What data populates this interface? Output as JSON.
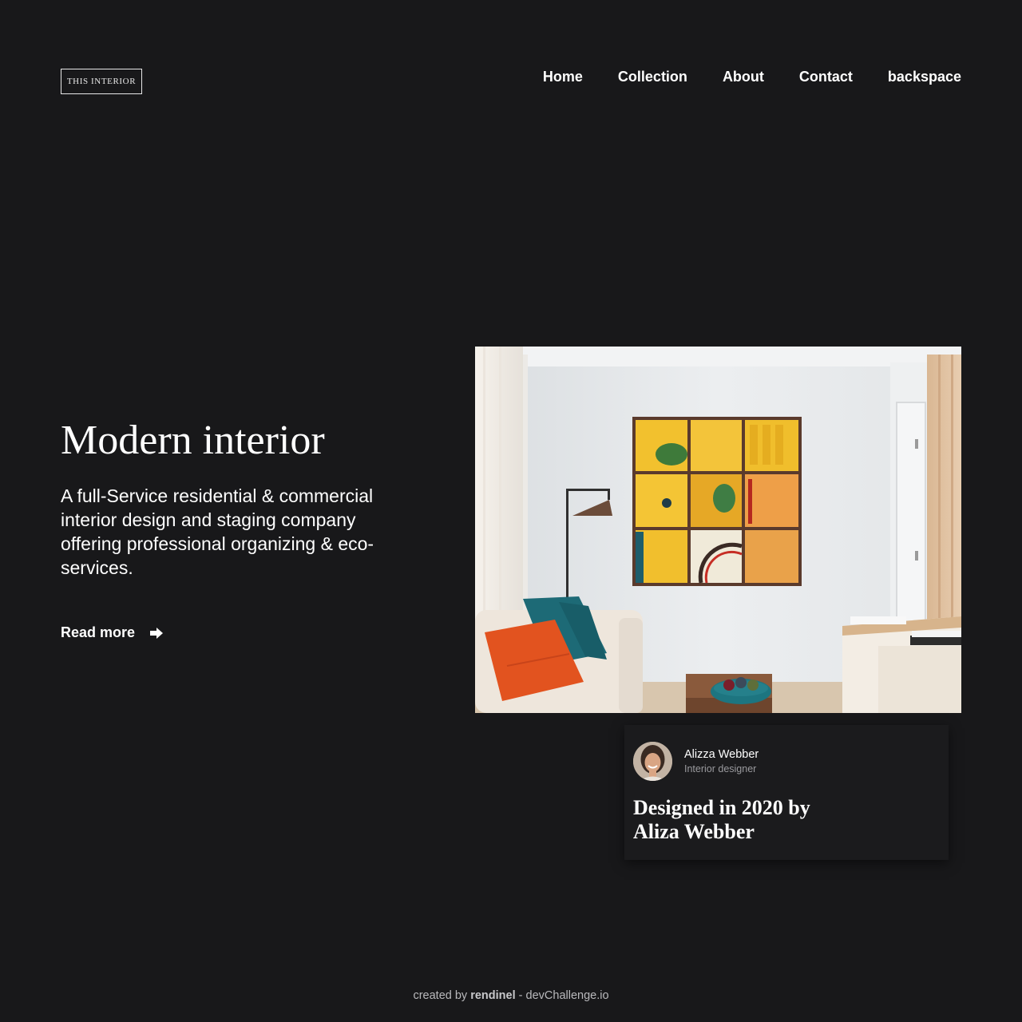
{
  "header": {
    "logo_text": "THIS INTERIOR",
    "nav": [
      {
        "label": "Home"
      },
      {
        "label": "Collection"
      },
      {
        "label": "About"
      },
      {
        "label": "Contact"
      },
      {
        "label": "backspace"
      }
    ]
  },
  "hero": {
    "title": "Modern interior",
    "description": "A full-Service residential & commercial interior design and staging company offering professional organizing & eco-services.",
    "cta_label": "Read more",
    "cta_icon": "arrow-right-icon"
  },
  "card": {
    "author_name": "Alizza Webber",
    "author_role": "Interior designer",
    "title": "Designed in 2020 by Aliza Webber"
  },
  "footer": {
    "prefix": "created by",
    "author": "rendinel",
    "separator": "-",
    "site": "devChallenge.io"
  },
  "colors": {
    "background": "#18181a",
    "card_background": "#1b1b1d",
    "text": "#ffffff",
    "muted_text": "#9a9a9e",
    "accent_yellow": "#f2c12e",
    "accent_orange": "#e2531f",
    "accent_teal": "#1e6b77"
  }
}
